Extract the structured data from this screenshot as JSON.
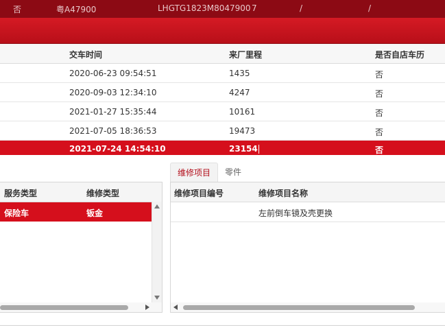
{
  "topbar": {
    "fields": [
      "否",
      "粤A47900",
      "LHGTG1823M8047900",
      "7",
      "/",
      "/"
    ]
  },
  "history_table": {
    "headers": [
      "交车时间",
      "来厂里程",
      "是否自店车历"
    ],
    "rows": [
      {
        "time": "2020-06-23 09:54:51",
        "mileage": "1435",
        "own": "否"
      },
      {
        "time": "2020-09-03 12:34:10",
        "mileage": "4247",
        "own": "否"
      },
      {
        "time": "2021-01-27 15:35:44",
        "mileage": "10161",
        "own": "否"
      },
      {
        "time": "2021-07-05 18:36:53",
        "mileage": "19473",
        "own": "否"
      },
      {
        "time": "2021-07-24 14:54:10",
        "mileage": "23154",
        "own": "否"
      }
    ],
    "selected_index": 4
  },
  "tabs": {
    "items": [
      "维修项目",
      "零件"
    ],
    "active_index": 0
  },
  "service_table": {
    "headers": [
      "服务类型",
      "维修类型"
    ],
    "rows": [
      {
        "service": "保险车",
        "repair": "钣金"
      }
    ]
  },
  "items_table": {
    "headers": [
      "维修项目编号",
      "维修项目名称"
    ],
    "rows": [
      {
        "code": "",
        "name": "左前倒车镜及壳更换"
      }
    ]
  },
  "colors": {
    "topbar": "#8c0a14",
    "accent_red": "#d50f1c",
    "band": "#c4141e"
  }
}
